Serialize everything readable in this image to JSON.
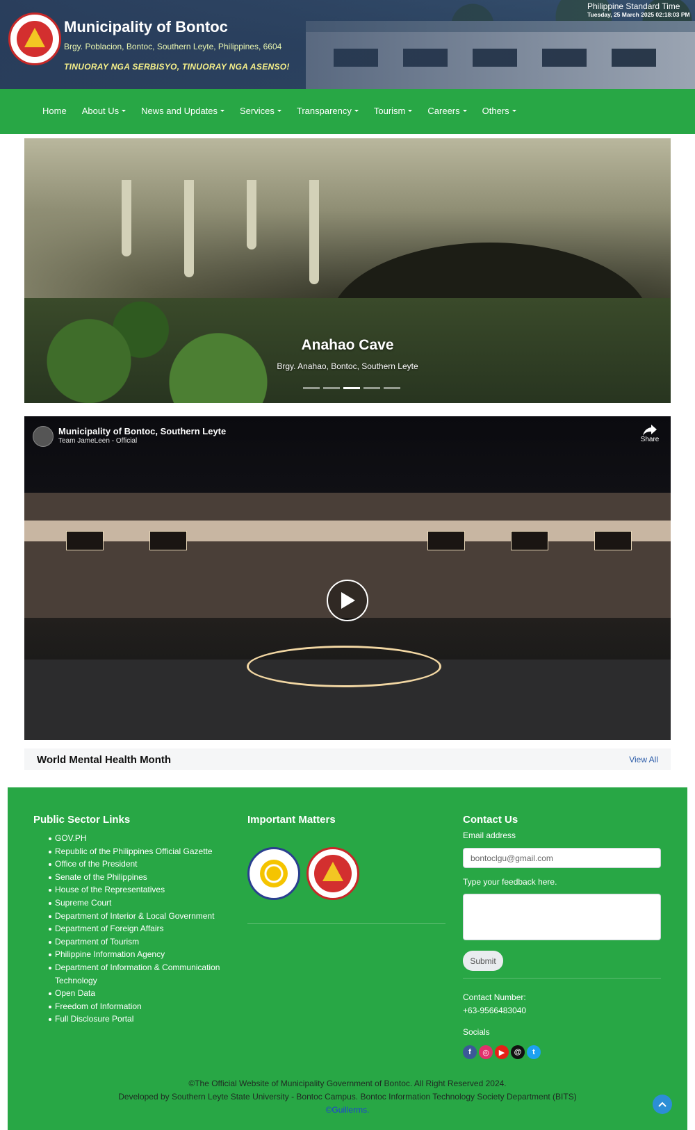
{
  "header": {
    "title": "Municipality of Bontoc",
    "address": "Brgy. Poblacion, Bontoc, Southern Leyte, Philippines, 6604",
    "motto": "TINUORAY NGA SERBISYO, TINUORAY NGA ASENSO!",
    "time_label": "Philippine Standard Time",
    "time_value": "Tuesday, 25 March 2025 02:18:03 PM"
  },
  "nav": {
    "items": [
      {
        "label": "Home",
        "dropdown": false
      },
      {
        "label": "About Us",
        "dropdown": true
      },
      {
        "label": "News and Updates",
        "dropdown": true
      },
      {
        "label": "Services",
        "dropdown": true
      },
      {
        "label": "Transparency",
        "dropdown": true
      },
      {
        "label": "Tourism",
        "dropdown": true
      },
      {
        "label": "Careers",
        "dropdown": true
      },
      {
        "label": "Others",
        "dropdown": true
      }
    ]
  },
  "hero": {
    "title": "Anahao Cave",
    "subtitle": "Brgy. Anahao, Bontoc, Southern Leyte",
    "slide_count": 5,
    "active_slide": 3
  },
  "video": {
    "title": "Municipality of Bontoc, Southern Leyte",
    "channel": "Team JameLeen - Official",
    "share_label": "Share"
  },
  "news": {
    "title": "World Mental Health Month",
    "view_all": "View All"
  },
  "footer": {
    "links_title": "Public Sector Links",
    "links": [
      "GOV.PH",
      "Republic of the Philippines Official Gazette",
      "Office of the President",
      "Senate of the Philippines",
      "House of the Representatives",
      "Supreme Court",
      "Department of Interior & Local Government",
      "Department of Foreign Affairs",
      "Department of Tourism",
      "Philippine Information Agency",
      "Department of Information & Communication",
      "Technology",
      "Open Data",
      "Freedom of Information",
      "Full Disclosure Portal"
    ],
    "matters_title": "Important Matters",
    "contact_title": "Contact Us",
    "email_label": "Email address",
    "email_value": "bontoclgu@gmail.com",
    "feedback_label": "Type your feedback here.",
    "submit_label": "Submit",
    "contact_number_label": "Contact Number:",
    "contact_number": "+63-9566483040",
    "socials_label": "Socials",
    "socials": [
      {
        "name": "facebook-icon",
        "glyph": "f",
        "color": "#3b5998"
      },
      {
        "name": "instagram-icon",
        "glyph": "◎",
        "color": "#e1306c"
      },
      {
        "name": "youtube-icon",
        "glyph": "▶",
        "color": "#e62117"
      },
      {
        "name": "threads-icon",
        "glyph": "@",
        "color": "#111111"
      },
      {
        "name": "twitter-icon",
        "glyph": "t",
        "color": "#1da1f2"
      }
    ],
    "copyright": "©The Official Website of Municipality Government of Bontoc. All Right Reserved 2024.",
    "developer": "Developed by Southern Leyte State University - Bontoc Campus. Bontoc Information Technology Society Department (BITS)",
    "credit": "©Guillerms."
  },
  "colors": {
    "brand_green": "#28a745",
    "header_blue": "#34506c",
    "motto_yellow": "#f6f08a"
  }
}
